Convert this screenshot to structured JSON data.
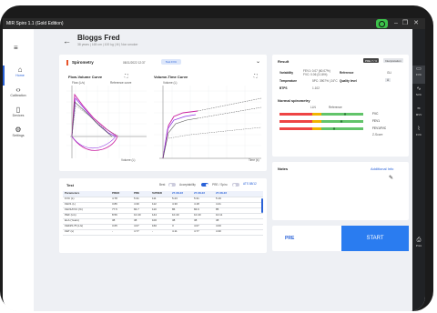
{
  "window": {
    "title": "MIR Spiro 1.1 (Gold Edition)"
  },
  "sidebar": {
    "items": [
      {
        "label": "Home"
      },
      {
        "label": "Calibration"
      },
      {
        "label": "Devices"
      },
      {
        "label": "Settings"
      }
    ]
  },
  "patient": {
    "name": "Bloggs Fred",
    "details": "38 years  |  165 cm  |  100 kg  |  M  |  Non smoker"
  },
  "spirometry": {
    "title": "Spirometry",
    "date": "08/11/2022 12:37",
    "chip": "Test FVC",
    "fv_title": "Flow-Volume Curve",
    "fv_flow_label": "Flow (L/s)",
    "fv_ref_label": "Reference curve",
    "fv_vol_label": "Volume (L)",
    "vt_title": "Volume-Time Curve",
    "vt_vol_label": "Volume (L)",
    "vt_time_label": "Time (s)"
  },
  "test": {
    "title": "Test",
    "best_label": "Best",
    "acc_label": "Acceptability",
    "pre_label": "PRE / Spiro",
    "ats_label": "ATS 88/12",
    "headers": [
      "Parameters",
      "PRED",
      "PRE",
      "%PRED",
      "27-08-22",
      "27-08-22",
      "27-08-22"
    ],
    "rows": [
      [
        "FVC (L)",
        "4.78",
        "5.31",
        "111",
        "5.23",
        "5.31",
        "5.19"
      ],
      [
        "FEV1 (L)",
        "3.86",
        "4.30",
        "112",
        "4.30",
        "4.18",
        "4.21"
      ],
      [
        "FEV1/FVC (%)",
        "77.5",
        "84.7",
        "110",
        "86",
        "84.6",
        "85"
      ],
      [
        "PEF (L/s)",
        "8.56",
        "10.40",
        "144",
        "10.40",
        "10.40",
        "10.11"
      ],
      [
        "ELA (Years)",
        "38",
        "38",
        "100",
        "38",
        "38",
        "38"
      ],
      [
        "FEF25-75 (L/s)",
        "3.65",
        "4.07",
        "160",
        "3",
        "4.07",
        "4.00"
      ],
      [
        "FET (s)",
        "-",
        "4.77",
        "-",
        "4.11",
        "4.77",
        "4.30"
      ]
    ]
  },
  "result": {
    "title": "Result",
    "pre_tag": "PRE 7 / 3",
    "interp_tag": "Interpretation",
    "variability_label": "Variability",
    "variability_value": "FEV1: 0.07 (60.07%) FVC: 0.06 (3.16%)",
    "temperature_label": "Temperature",
    "temperature_value": "5PC: 3907% | 24°C",
    "btps_label": "BTPS",
    "btps_value": "1.102",
    "reference_label": "Reference",
    "reference_value": "GLI",
    "quality_label": "Quality level",
    "quality_value": "A",
    "normal_title": "Normal spirometry",
    "lln_label": "LLN",
    "ref_label": "Reference",
    "zscore_label": "Z-Score",
    "bars": [
      {
        "name": "FVC"
      },
      {
        "name": "FEV1"
      },
      {
        "name": "FEV1/FVC"
      }
    ]
  },
  "notes": {
    "title": "Notes",
    "add_label": "Additional Info"
  },
  "actions": {
    "pre_label": "PRE",
    "start_label": "START"
  },
  "rightbar": {
    "items": [
      {
        "label": "FVC"
      },
      {
        "label": "SVC"
      },
      {
        "label": "MVV"
      },
      {
        "label": "FVC"
      },
      {
        "label": "Print"
      }
    ]
  }
}
